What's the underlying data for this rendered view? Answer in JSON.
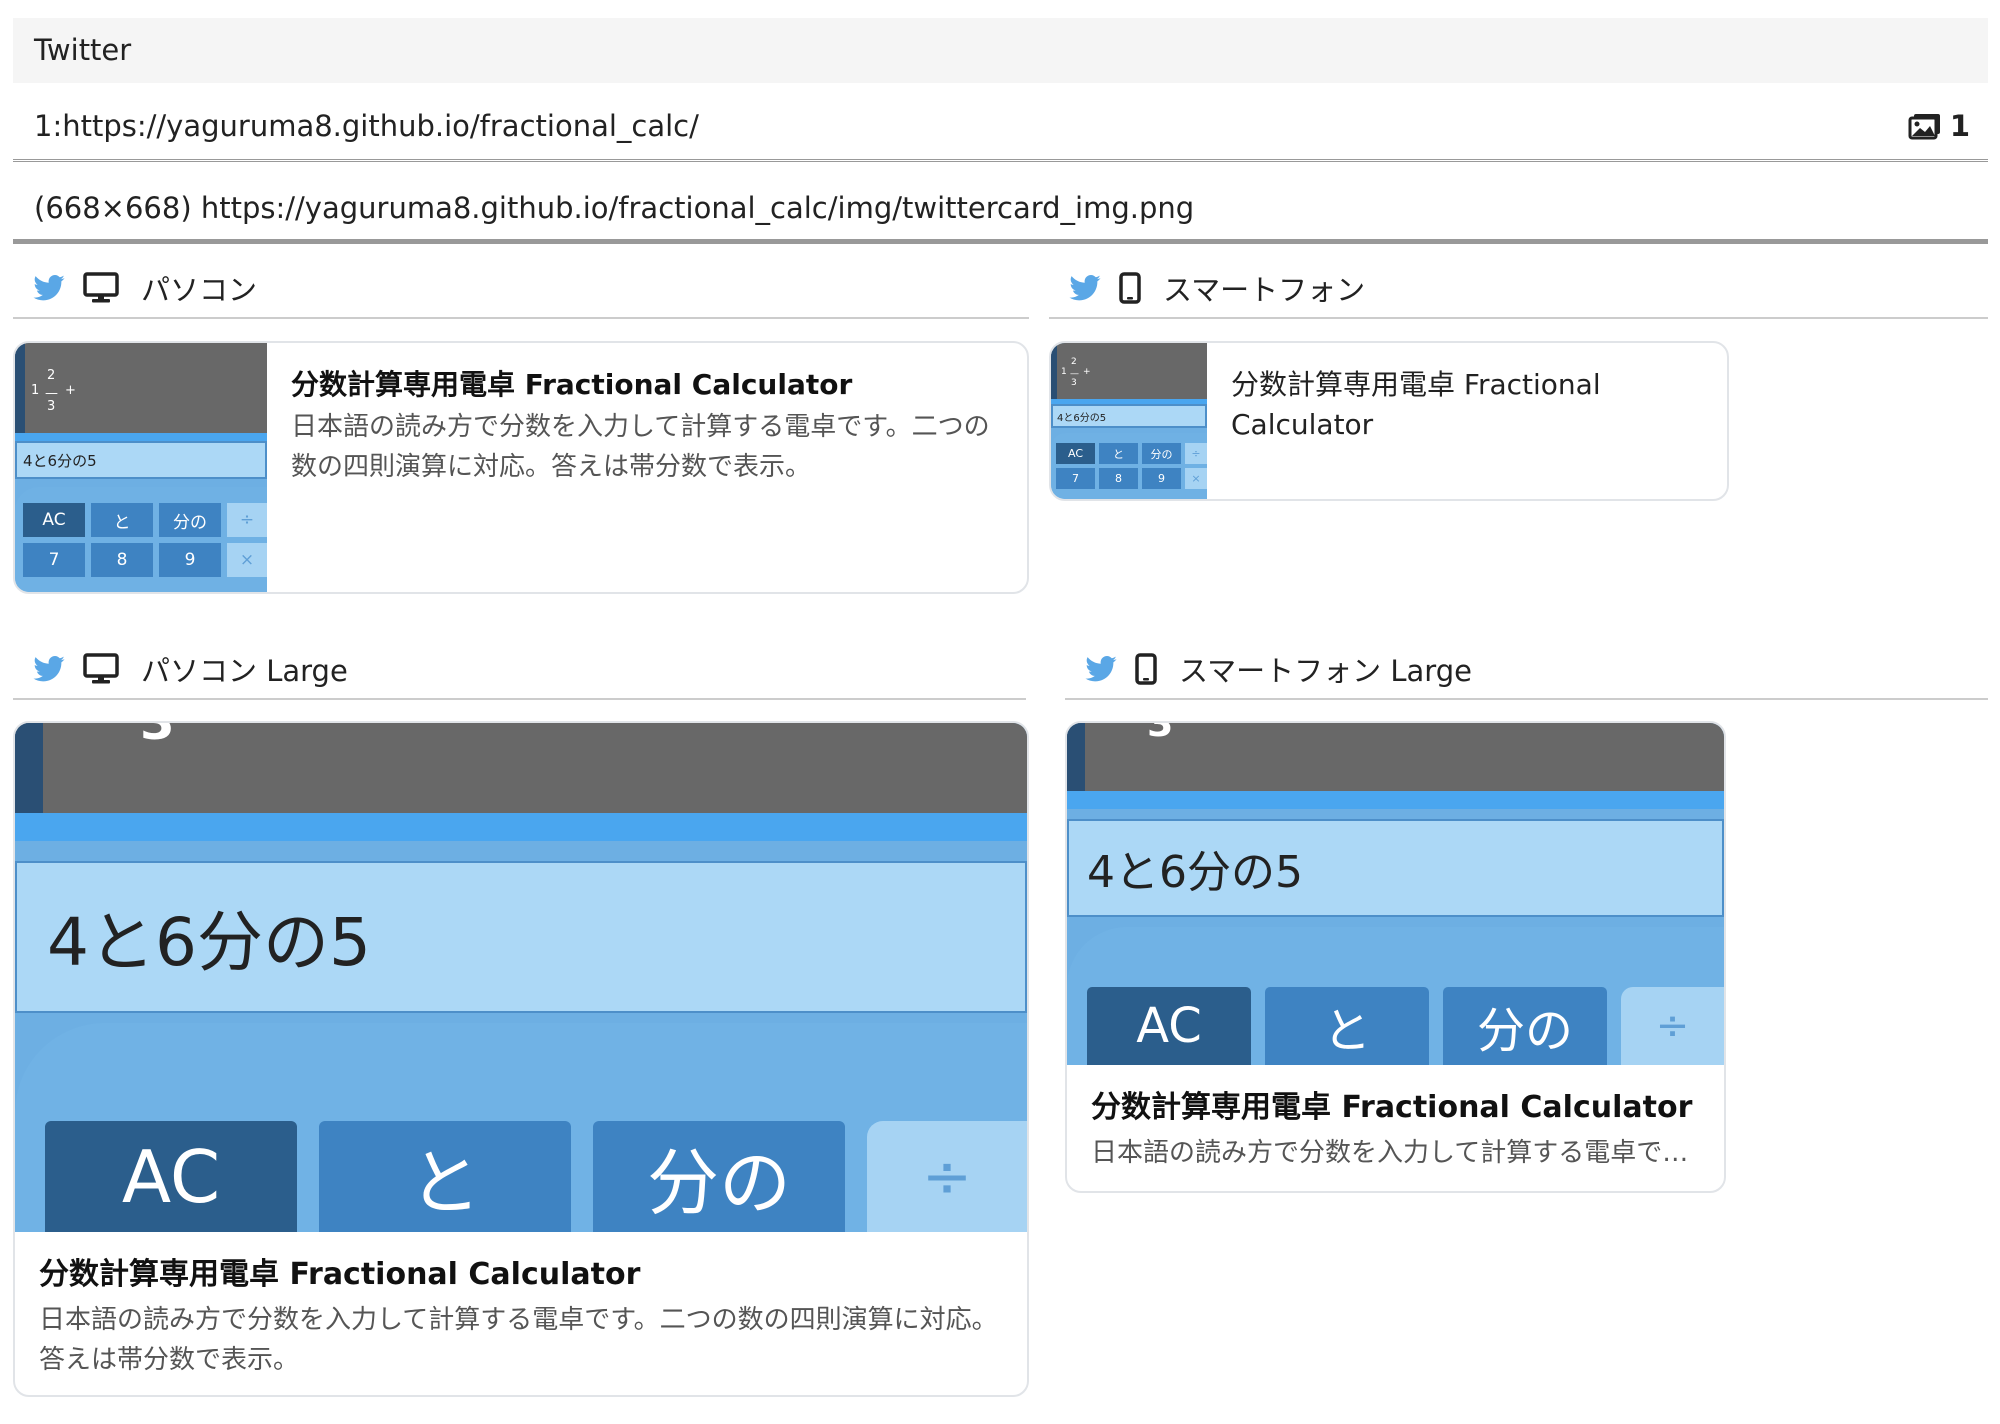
{
  "header": {
    "title": "Twitter",
    "url": "1:https://yaguruma8.github.io/fractional_calc/",
    "image_count": "1",
    "image_info": "(668×668) https://yaguruma8.github.io/fractional_calc/img/twittercard_img.png"
  },
  "sections": {
    "pc": "パソコン",
    "phone": "スマートフォン",
    "pc_large": "パソコン Large",
    "phone_large": "スマートフォン Large"
  },
  "card": {
    "title": "分数計算専用電卓 Fractional Calculator",
    "description": "日本語の読み方で分数を入力して計算する電卓です。二つの数の四則演算に対応。答えは帯分数で表示。"
  },
  "calculator": {
    "numerator": "2",
    "whole": "1",
    "denominator": "3",
    "plus": "+",
    "large_top_digit": "3",
    "display": "4と6分の5",
    "keys_row1": [
      "AC",
      "と",
      "分の",
      "÷"
    ],
    "keys_row2": [
      "7",
      "8",
      "9",
      "×"
    ]
  },
  "icons": [
    "twitter-bird-icon",
    "desktop-icon",
    "smartphone-icon",
    "images-icon"
  ],
  "colors": {
    "twitter": "#5aa7e6",
    "screen": "#686868",
    "display": "#acd8f6",
    "key_dark": "#2b5e8c",
    "key": "#3e83c2"
  }
}
